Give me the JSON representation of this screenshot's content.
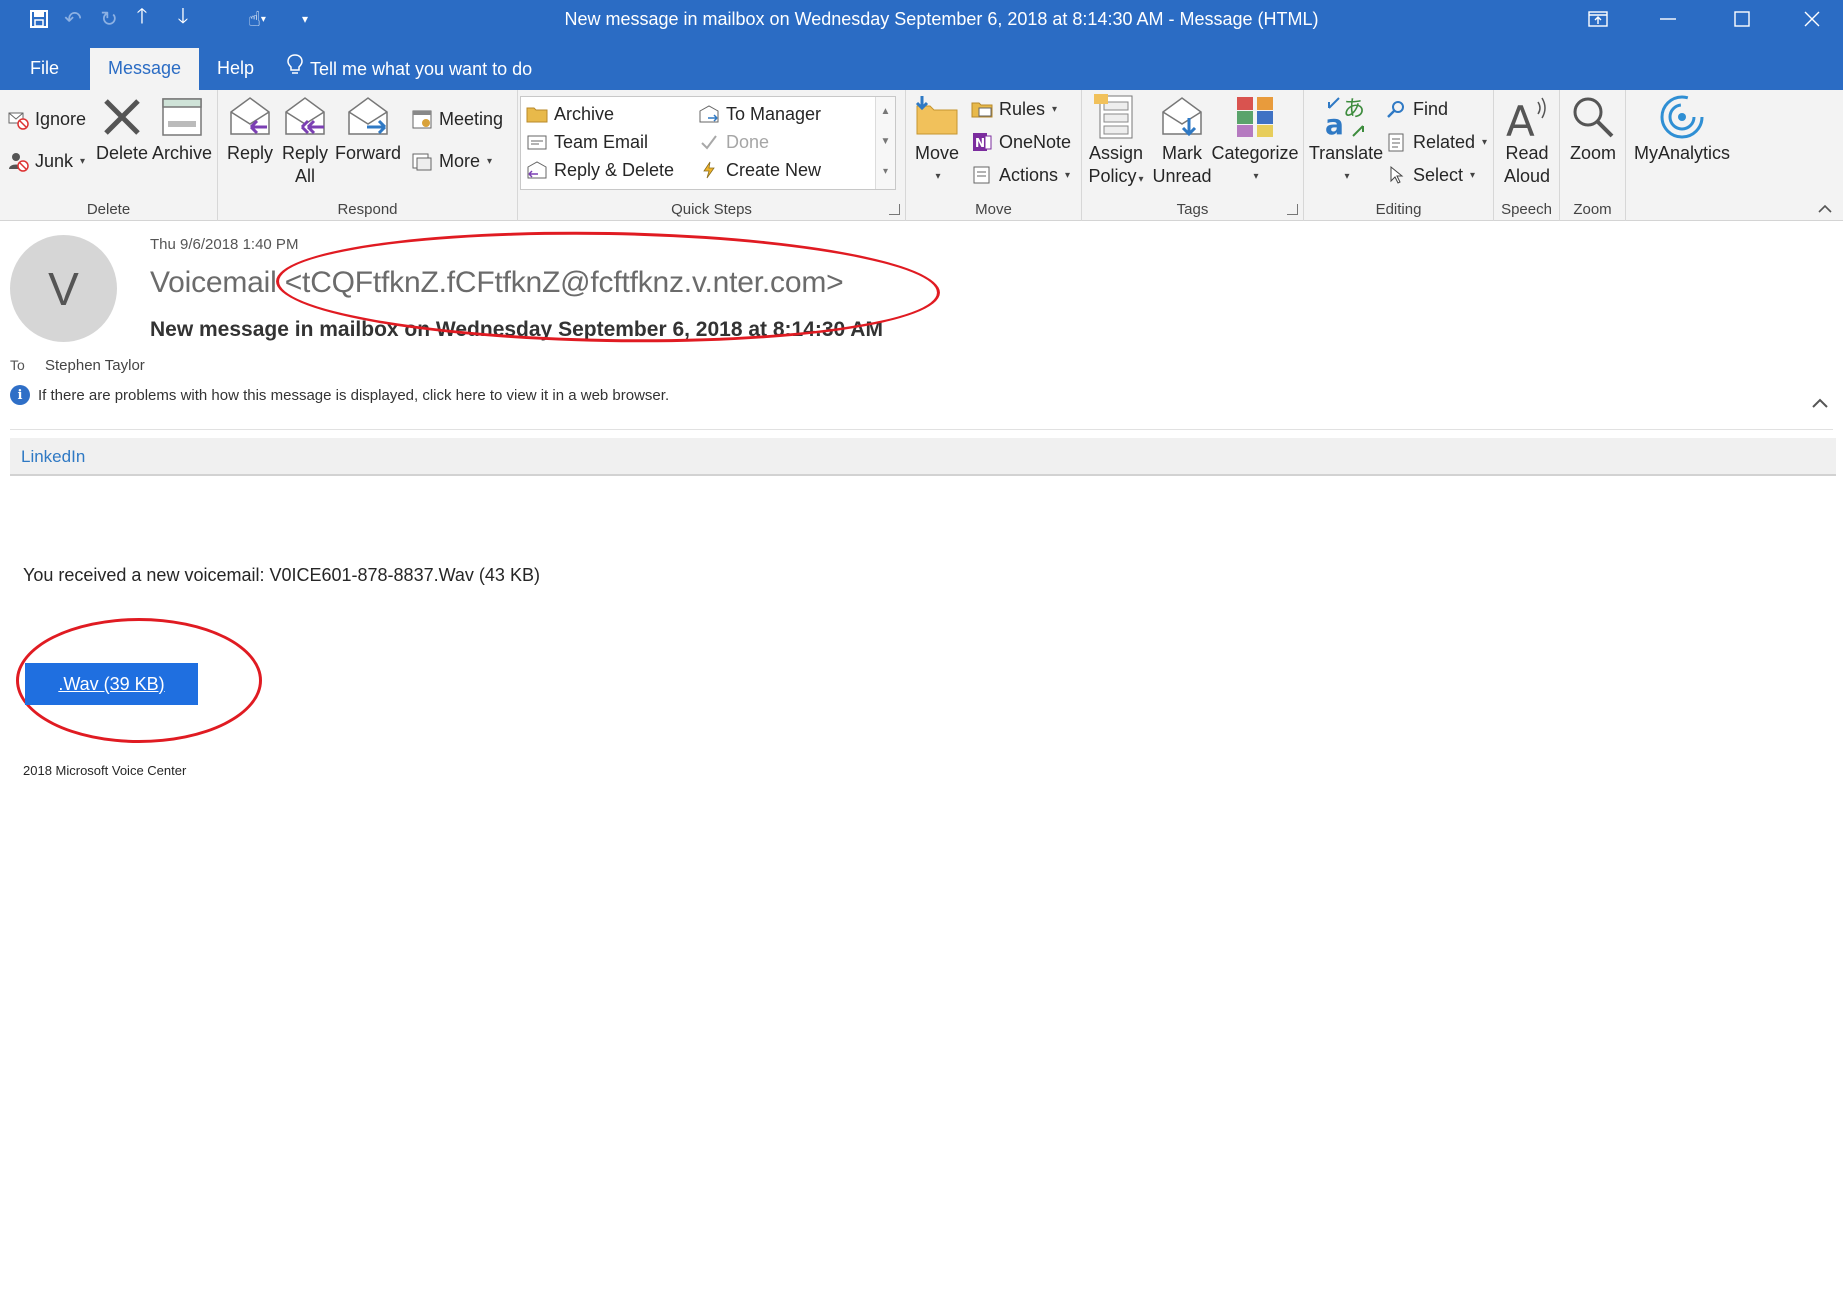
{
  "window": {
    "title": "New message in mailbox on Wednesday September 6, 2018 at 8:14:30 AM  -  Message (HTML)"
  },
  "menu": {
    "tabs": [
      "File",
      "Message",
      "Help"
    ],
    "active_tab": "Message",
    "tell_me": "Tell me what you want to do"
  },
  "ribbon": {
    "delete": {
      "label": "Delete",
      "ignore": "Ignore",
      "junk": "Junk",
      "delete": "Delete",
      "archive": "Archive"
    },
    "respond": {
      "label": "Respond",
      "reply": "Reply",
      "reply_all_1": "Reply",
      "reply_all_2": "All",
      "forward": "Forward",
      "meeting": "Meeting",
      "more": "More"
    },
    "quick_steps": {
      "label": "Quick Steps",
      "items": [
        "Archive",
        "To Manager",
        "Team Email",
        "Done",
        "Reply & Delete",
        "Create New"
      ]
    },
    "move": {
      "label": "Move",
      "move": "Move",
      "rules": "Rules",
      "onenote": "OneNote",
      "actions": "Actions"
    },
    "tags": {
      "label": "Tags",
      "assign_1": "Assign",
      "assign_2": "Policy",
      "mark_1": "Mark",
      "mark_2": "Unread",
      "categorize": "Categorize"
    },
    "editing": {
      "label": "Editing",
      "translate": "Translate",
      "find": "Find",
      "related": "Related",
      "select": "Select"
    },
    "speech": {
      "label": "Speech",
      "read_1": "Read",
      "read_2": "Aloud"
    },
    "zoom": {
      "label": "Zoom",
      "zoom": "Zoom"
    },
    "myanalytics": "MyAnalytics"
  },
  "message": {
    "avatar_initial": "V",
    "date": "Thu 9/6/2018 1:40 PM",
    "sender_name": "Voicemail",
    "sender_email": "<tCQFtfknZ.fCFtfknZ@fcftfknz.v.nter.com>",
    "subject": "New message in mailbox on Wednesday September 6, 2018 at 8:14:30 AM",
    "to_label": "To",
    "to_name": "Stephen Taylor",
    "info_text": "If there are problems with how this message is displayed, click here to view it in a web browser."
  },
  "body": {
    "linkedin_link": "LinkedIn",
    "voicemail_text": "You received a new voicemail: V0ICE601-878-8837.Wav (43 KB)",
    "wav_button": ".Wav (39 KB)",
    "footer": "2018 Microsoft Voice Center"
  },
  "colors": {
    "title_bar": "#2b6cc4",
    "ribbon_bg": "#f3f3f3",
    "link": "#2f79c4",
    "wav_button": "#1f6fe0",
    "annotation": "#e01b22"
  }
}
